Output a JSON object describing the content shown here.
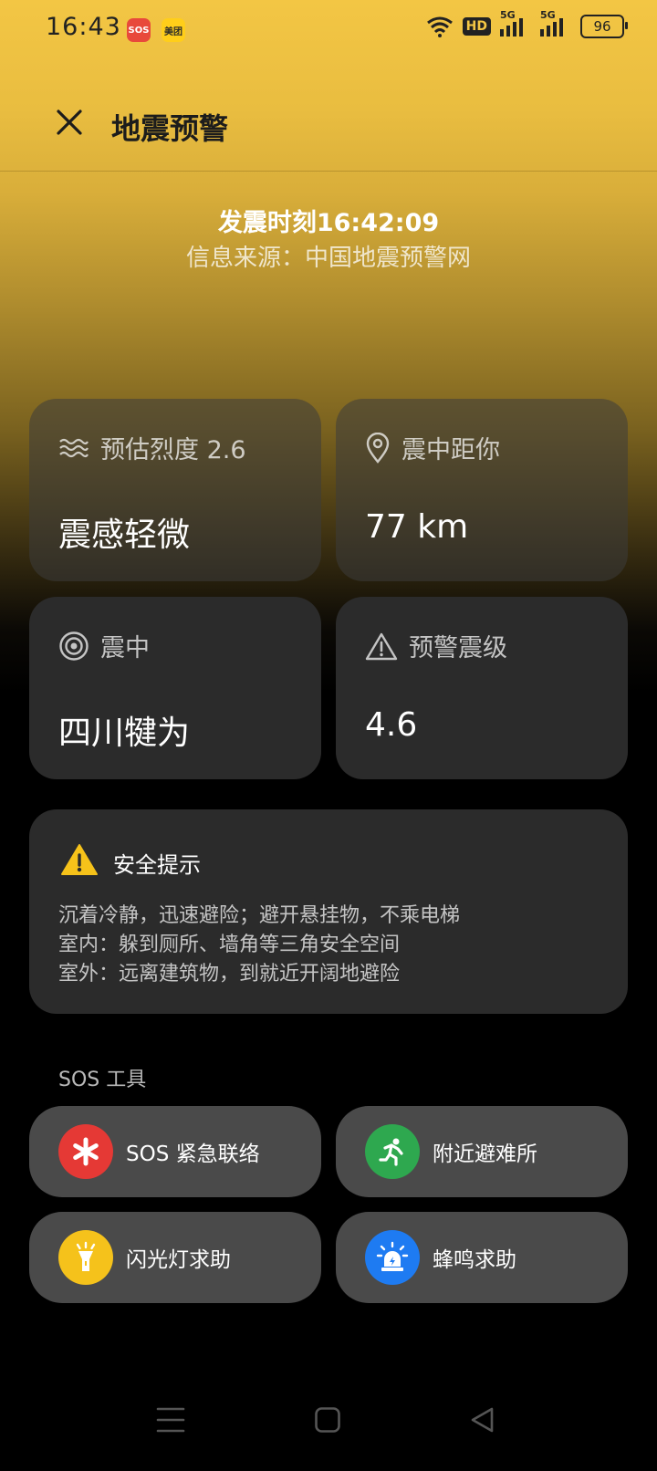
{
  "status": {
    "time": "16:43",
    "sos_badge": "SOS",
    "app_badge": "美团",
    "hd": "HD",
    "net1": "5G",
    "net2": "5G",
    "battery": "96"
  },
  "header": {
    "title": "地震预警"
  },
  "quake": {
    "time_text": "发震时刻16:42:09",
    "source_text": "信息来源：中国地震预警网"
  },
  "cards": {
    "intensity": {
      "label": "预估烈度 2.6",
      "value": "震感轻微"
    },
    "distance": {
      "label": "震中距你",
      "value": "77 km"
    },
    "epicenter": {
      "label": "震中",
      "value": "四川犍为"
    },
    "magnitude": {
      "label": "预警震级",
      "value": "4.6"
    }
  },
  "tips": {
    "title": "安全提示",
    "lines": [
      "沉着冷静，迅速避险；避开悬挂物，不乘电梯",
      "室内：躲到厕所、墙角等三角安全空间",
      "室外：远离建筑物，到就近开阔地避险"
    ]
  },
  "sos": {
    "label": "SOS 工具",
    "tools": [
      {
        "label": "SOS 紧急联络",
        "color": "#e53935"
      },
      {
        "label": "附近避难所",
        "color": "#2ea84f"
      },
      {
        "label": "闪光灯求助",
        "color": "#f5c21b"
      },
      {
        "label": "蜂鸣求助",
        "color": "#1e7bf2"
      }
    ]
  }
}
